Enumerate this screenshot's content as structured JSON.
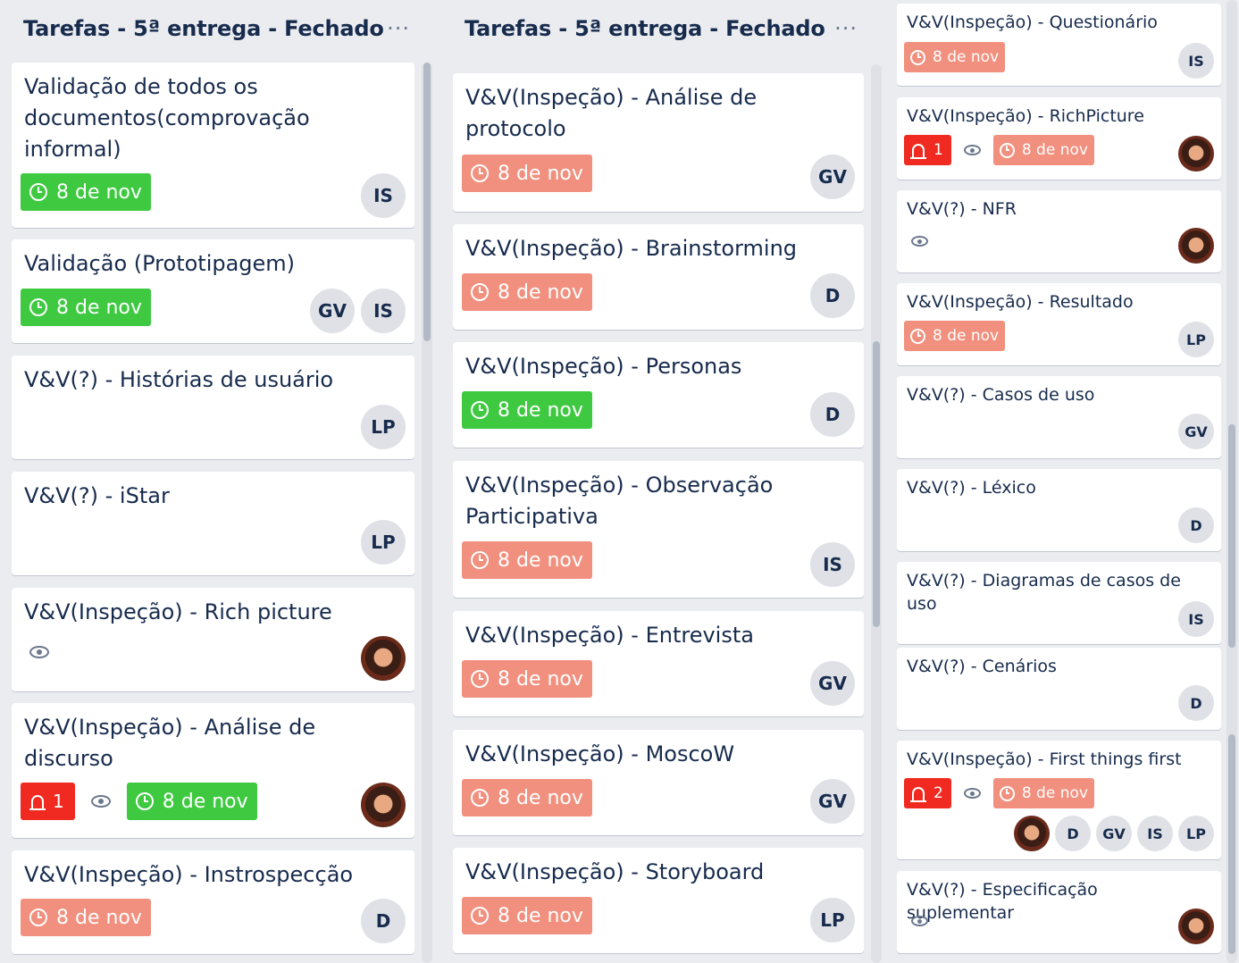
{
  "colors": {
    "board_bg": "#ebecf0",
    "due_green": "#3ec941",
    "due_salmon": "#f1907e",
    "notif_red": "#f02a20"
  },
  "columns": [
    {
      "title": "Tarefas - 5ª entrega - Fechado",
      "menu": "···"
    },
    {
      "title": "Tarefas - 5ª entrega - Fechado",
      "menu": "···"
    }
  ],
  "col1": [
    {
      "title": "Validação de todos os documentos(comprovação informal)",
      "due": "8 de nov",
      "members": [
        "IS"
      ]
    },
    {
      "title": "Validação (Prototipagem)",
      "due": "8 de nov",
      "members": [
        "GV",
        "IS"
      ]
    },
    {
      "title": "V&V(?) - Histórias de usuário",
      "members": [
        "LP"
      ]
    },
    {
      "title": "V&V(?) - iStar",
      "members": [
        "LP"
      ]
    },
    {
      "title": "V&V(Inspeção) - Rich picture",
      "watch": "eye-icon",
      "members": [
        "photo"
      ]
    },
    {
      "title": "V&V(Inspeção) - Análise de discurso",
      "notif": "1",
      "due": "8 de nov",
      "members": [
        "photo"
      ]
    },
    {
      "title": "V&V(Inspeção) - Instrospecção",
      "due": "8 de nov",
      "members": [
        "D"
      ]
    }
  ],
  "col2": [
    {
      "title": "V&V(Inspeção) - Análise de protocolo",
      "due": "8 de nov",
      "members": [
        "GV"
      ]
    },
    {
      "title": "V&V(Inspeção) - Brainstorming",
      "due": "8 de nov",
      "members": [
        "D"
      ]
    },
    {
      "title": "V&V(Inspeção) - Personas",
      "due": "8 de nov",
      "members": [
        "D"
      ]
    },
    {
      "title": "V&V(Inspeção) - Observação Participativa",
      "due": "8 de nov",
      "members": [
        "IS"
      ]
    },
    {
      "title": "V&V(Inspeção) - Entrevista",
      "due": "8 de nov",
      "members": [
        "GV"
      ]
    },
    {
      "title": "V&V(Inspeção) - MoscoW",
      "due": "8 de nov",
      "members": [
        "GV"
      ]
    },
    {
      "title": "V&V(Inspeção) - Storyboard",
      "due": "8 de nov",
      "members": [
        "LP"
      ]
    }
  ],
  "col3": [
    {
      "title": "V&V(Inspeção) - Questionário",
      "due": "8 de nov",
      "members": [
        "IS"
      ]
    },
    {
      "title": "V&V(Inspeção) - RichPicture",
      "notif": "1",
      "due": "8 de nov",
      "members": [
        "photo"
      ]
    },
    {
      "title": "V&V(?) - NFR",
      "members": [
        "photo"
      ]
    },
    {
      "title": "V&V(Inspeção) - Resultado",
      "due": "8 de nov",
      "members": [
        "LP"
      ]
    },
    {
      "title": "V&V(?) - Casos de uso",
      "members": [
        "GV"
      ]
    },
    {
      "title": "V&V(?) - Léxico",
      "members": [
        "D"
      ]
    },
    {
      "title": "V&V(?) - Diagramas de casos de uso",
      "members": [
        "IS"
      ]
    },
    {
      "title": "V&V(?) - Cenários",
      "members": [
        "D"
      ]
    },
    {
      "title": "V&V(Inspeção) - First things first",
      "notif": "2",
      "due": "8 de nov",
      "members": [
        "photo",
        "D",
        "GV",
        "IS",
        "LP"
      ]
    },
    {
      "title": "V&V(?) - Especificação suplementar",
      "members": [
        "photo"
      ]
    }
  ]
}
